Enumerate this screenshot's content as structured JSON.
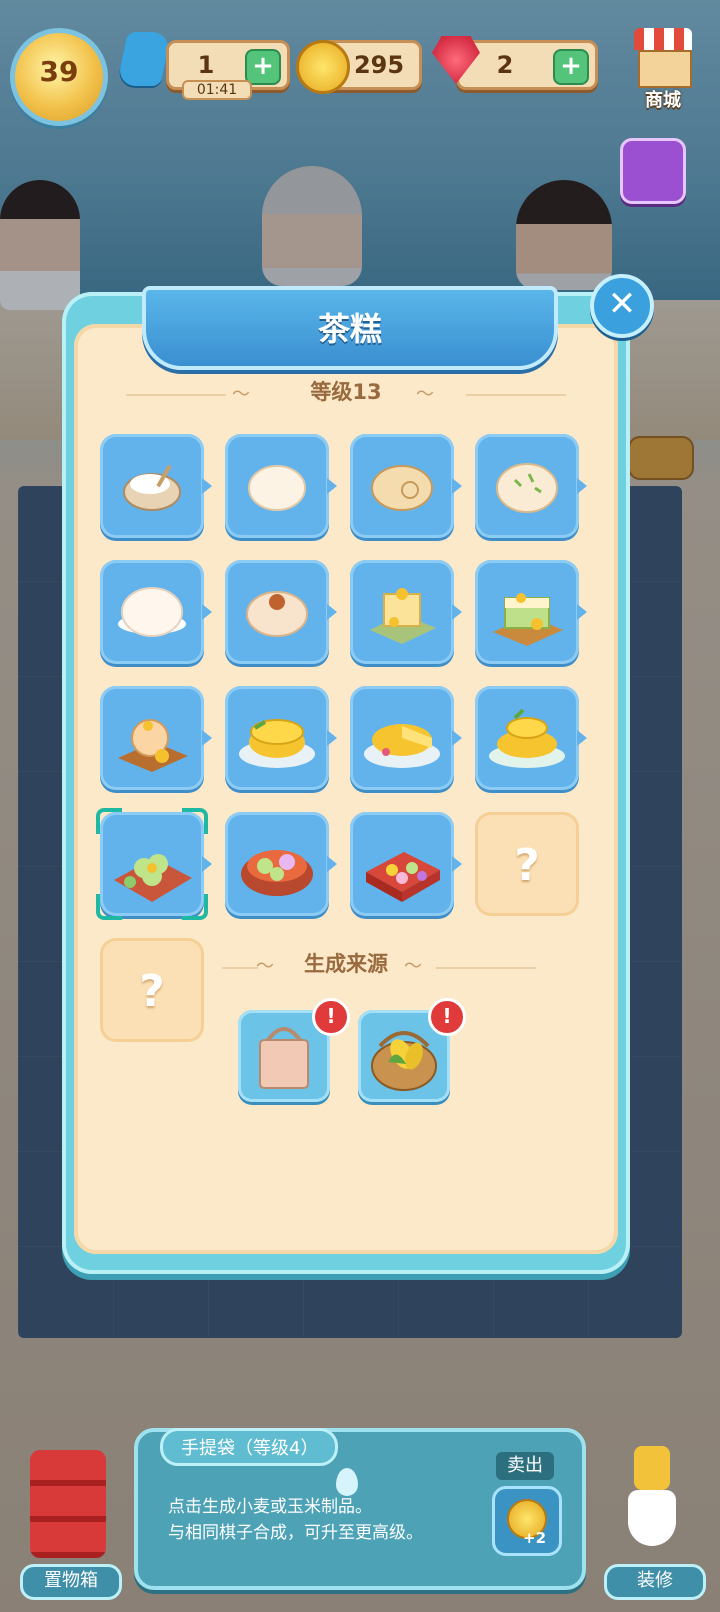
{
  "top_bar": {
    "level": "39",
    "energy": "1",
    "energy_timer": "01:41",
    "coins": "295",
    "gems": "2",
    "shop_label": "商城",
    "plus_label": "+"
  },
  "popup": {
    "title": "茶糕",
    "close_label": "✕",
    "level_section": "等级13",
    "items": [
      {
        "icon": "flour-bowl-icon"
      },
      {
        "icon": "dough-ball-icon"
      },
      {
        "icon": "roll-bread-icon"
      },
      {
        "icon": "scallion-bun-icon"
      },
      {
        "icon": "steamed-bun-icon"
      },
      {
        "icon": "sesame-bun-icon"
      },
      {
        "icon": "flower-cake-icon"
      },
      {
        "icon": "layered-flower-cake-icon"
      },
      {
        "icon": "flower-tray-cake-icon"
      },
      {
        "icon": "citrus-cake-icon"
      },
      {
        "icon": "citrus-slice-cake-icon"
      },
      {
        "icon": "tiered-citrus-cake-icon"
      },
      {
        "icon": "green-flower-cake-tray-icon"
      },
      {
        "icon": "flower-cake-bowl-icon"
      },
      {
        "icon": "cake-gift-box-icon"
      },
      {
        "locked": true,
        "label": "?"
      },
      {
        "locked": true,
        "label": "?"
      }
    ],
    "source_section": "生成来源",
    "sources": [
      {
        "icon": "shopping-bag-icon",
        "alert": "!"
      },
      {
        "icon": "corn-basket-icon",
        "alert": "!"
      }
    ]
  },
  "bottom": {
    "item_title": "手提袋（等级4）",
    "desc_line1": "点击生成小麦或玉米制品。",
    "desc_line2": "与相同棋子合成，可升至更高级。",
    "sell_label": "卖出",
    "sell_value": "+2",
    "storage_label": "置物箱",
    "decorate_label": "装修"
  },
  "colors": {
    "popup_frame": "#6fd0df",
    "popup_bg": "#fbe9c9",
    "tile_blue": "#62b3ec",
    "tile_locked": "#fbe0b6",
    "selection": "#1fb8a2"
  }
}
